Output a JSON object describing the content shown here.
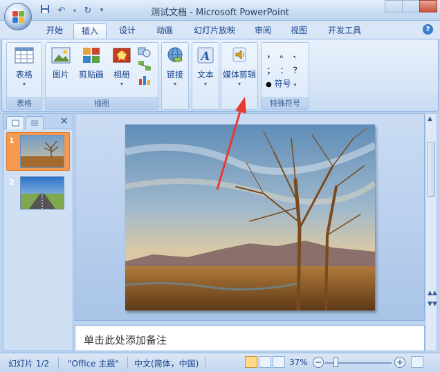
{
  "app": {
    "title": "测试文档 - Microsoft PowerPoint"
  },
  "tabs": [
    {
      "label": "开始",
      "active": false
    },
    {
      "label": "插入",
      "active": true
    },
    {
      "label": "设计",
      "active": false
    },
    {
      "label": "动画",
      "active": false
    },
    {
      "label": "幻灯片放映",
      "active": false
    },
    {
      "label": "审阅",
      "active": false
    },
    {
      "label": "视图",
      "active": false
    },
    {
      "label": "开发工具",
      "active": false
    }
  ],
  "ribbon": {
    "groups": [
      {
        "label": "表格",
        "buttons": [
          {
            "label": "表格"
          }
        ]
      },
      {
        "label": "插图",
        "buttons": [
          {
            "label": "图片"
          },
          {
            "label": "剪贴画"
          },
          {
            "label": "相册"
          }
        ]
      },
      {
        "label": "",
        "buttons": [
          {
            "label": "链接"
          }
        ]
      },
      {
        "label": "",
        "buttons": [
          {
            "label": "文本"
          }
        ]
      },
      {
        "label": "",
        "buttons": [
          {
            "label": "媒体剪辑"
          }
        ]
      },
      {
        "label": "特殊符号",
        "buttons": [
          {
            "label": "符号"
          }
        ]
      }
    ],
    "symbols": [
      "，",
      "。",
      "、",
      "；",
      "：",
      "？"
    ]
  },
  "slides_panel": {
    "slides": [
      {
        "number": "1",
        "selected": true
      },
      {
        "number": "2",
        "selected": false
      }
    ]
  },
  "notes": {
    "placeholder": "单击此处添加备注"
  },
  "statusbar": {
    "slide_info": "幻灯片 1/2",
    "theme": "\"Office 主题\"",
    "language": "中文(简体，中国)",
    "zoom": "37%",
    "zoom_minus": "−",
    "zoom_plus": "+"
  },
  "colors": {
    "accent": "#15428b",
    "ribbon_bg": "#d5e4f6",
    "selection": "#f59a4f",
    "annotation_arrow": "#e8392f"
  }
}
